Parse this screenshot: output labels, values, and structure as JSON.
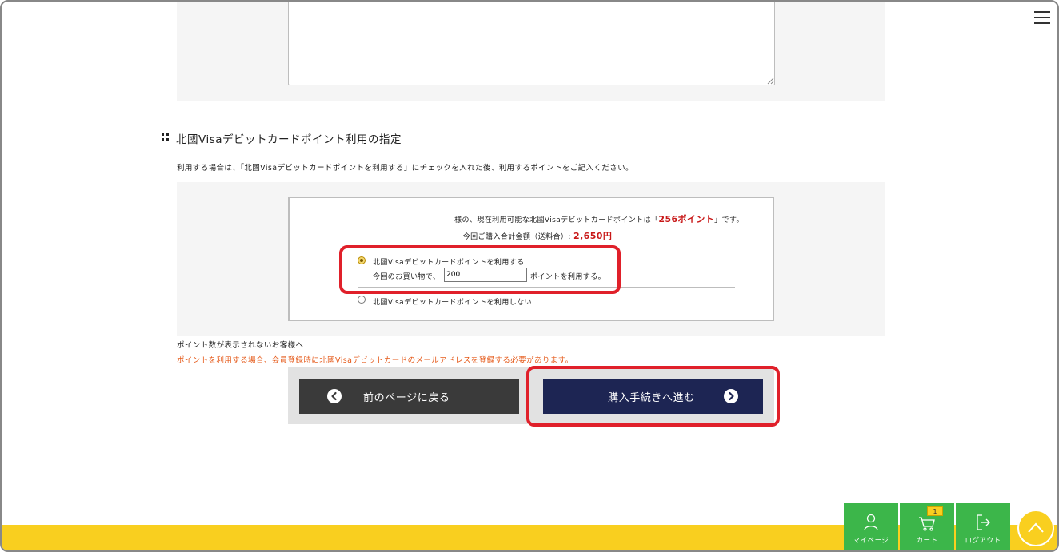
{
  "header": {
    "menu_icon": "hamburger-menu-icon"
  },
  "comment": {
    "value": ""
  },
  "points_section": {
    "title": "北國Visaデビットカードポイント利用の指定",
    "instruction": "利用する場合は、「北國Visaデビットカードポイントを利用する」にチェックを入れた後、利用するポイントをご記入ください。",
    "available_pre": "様の、現在利用可能な北國Visaデビットカードポイントは「",
    "available_points": "256ポイント",
    "available_post": "」です。",
    "total_label": "今回ご購入合計金額（送料合）:",
    "total_amount": "2,650円",
    "option_use_label": "北國Visaデビットカードポイントを利用する",
    "option_use_selected": true,
    "use_pre": "今回のお買い物で、",
    "points_value": "200",
    "use_post": "ポイントを利用する。",
    "option_nouse_label": "北國Visaデビットカードポイントを利用しない",
    "note": "ポイント数が表示されないお客様へ",
    "warning": "ポイントを利用する場合、会員登録時に北國Visaデビットカードのメールアドレスを登録する必要があります。"
  },
  "buttons": {
    "back_label": "前のページに戻る",
    "next_label": "購入手続きへ進む"
  },
  "footer_nav": {
    "mypage_label": "マイページ",
    "cart_label": "カート",
    "cart_count": "1",
    "logout_label": "ログアウト"
  },
  "colors": {
    "accent_yellow": "#f9cf1f",
    "nav_green": "#3cb64a",
    "next_button_navy": "#1d2553",
    "highlight_red": "#e0202a",
    "points_red": "#c81818",
    "warning_orange": "#e55a1a"
  }
}
